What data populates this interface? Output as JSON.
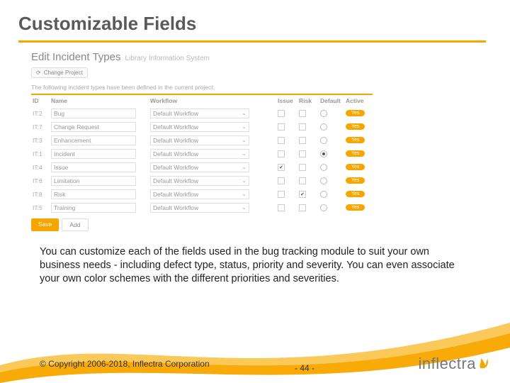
{
  "slide": {
    "title": "Customizable Fields",
    "body": "You can customize each of the fields used in the bug tracking module to suit your own business needs - including defect type, status, priority and severity. You can even associate your own color schemes with the different priorities and severities.",
    "copyright": "© Copyright 2006-2018, Inflectra Corporation",
    "page": "- 44 -",
    "logo_text": "inflectra"
  },
  "screenshot": {
    "header_title": "Edit Incident Types",
    "header_sub": "Library Information System",
    "change_project": "Change Project",
    "intro": "The following incident types have been defined in the current project:",
    "columns": [
      "ID",
      "Name",
      "Workflow",
      "Issue",
      "Risk",
      "Default",
      "Active"
    ],
    "workflow_default": "Default Workflow",
    "yes_label": "Yes",
    "rows": [
      {
        "id": "IT:2",
        "name": "Bug",
        "issue": false,
        "risk": false,
        "default": false
      },
      {
        "id": "IT:7",
        "name": "Change Request",
        "issue": false,
        "risk": false,
        "default": false
      },
      {
        "id": "IT:3",
        "name": "Enhancement",
        "issue": false,
        "risk": false,
        "default": false
      },
      {
        "id": "IT:1",
        "name": "Incident",
        "issue": false,
        "risk": false,
        "default": true
      },
      {
        "id": "IT:4",
        "name": "Issue",
        "issue": true,
        "risk": false,
        "default": false
      },
      {
        "id": "IT:6",
        "name": "Limitation",
        "issue": false,
        "risk": false,
        "default": false
      },
      {
        "id": "IT:8",
        "name": "Risk",
        "issue": false,
        "risk": true,
        "default": false
      },
      {
        "id": "IT:5",
        "name": "Training",
        "issue": false,
        "risk": false,
        "default": false
      }
    ],
    "save": "Save",
    "add": "Add"
  }
}
